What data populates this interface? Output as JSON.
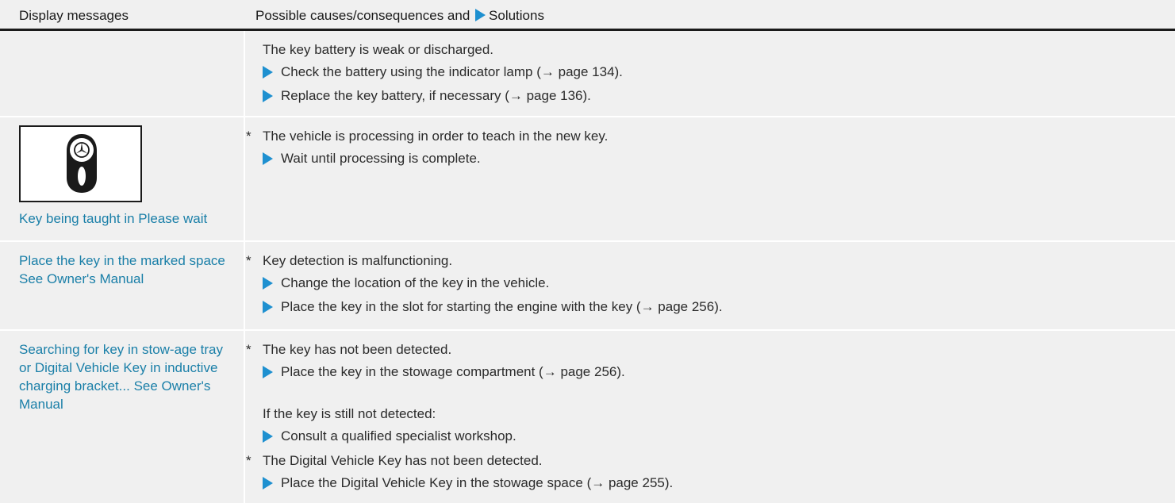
{
  "header": {
    "col1": "Display messages",
    "col2_prefix": "Possible causes/consequences and",
    "col2_suffix": "Solutions"
  },
  "rows": [
    {
      "message": "",
      "lines": {
        "l0": "The key battery is weak or discharged.",
        "l1": "Check the battery using the indicator lamp (→ page 134).",
        "l2": "Replace the key battery, if necessary (→ page 136)."
      }
    },
    {
      "message": "Key being taught in Please wait",
      "icon": "mercedes-key-icon",
      "lines": {
        "l0": "The vehicle is processing in order to teach in the new key.",
        "l1": "Wait until processing is complete."
      }
    },
    {
      "message": "Place the key in the marked space See Owner's Manual",
      "lines": {
        "l0": "Key detection is malfunctioning.",
        "l1": "Change the location of the key in the vehicle.",
        "l2": "Place the key in the slot for starting the engine with the key (→ page 256)."
      }
    },
    {
      "message": "Searching for key in stow-age tray or Digital Vehicle Key in inductive charging bracket... See Owner's Manual",
      "lines": {
        "l0": "The key has not been detected.",
        "l1": "Place the key in the stowage compartment (→ page 256).",
        "l2": "If the key is still not detected:",
        "l3": "Consult a qualified specialist workshop.",
        "l4": "The Digital Vehicle Key has not been detected.",
        "l5": "Place the Digital Vehicle Key in the stowage space (→ page 255)."
      }
    }
  ],
  "colors": {
    "accent_blue": "#1e90d0",
    "message_blue": "#1a7fa8",
    "row_bg": "#f0f0f0"
  }
}
